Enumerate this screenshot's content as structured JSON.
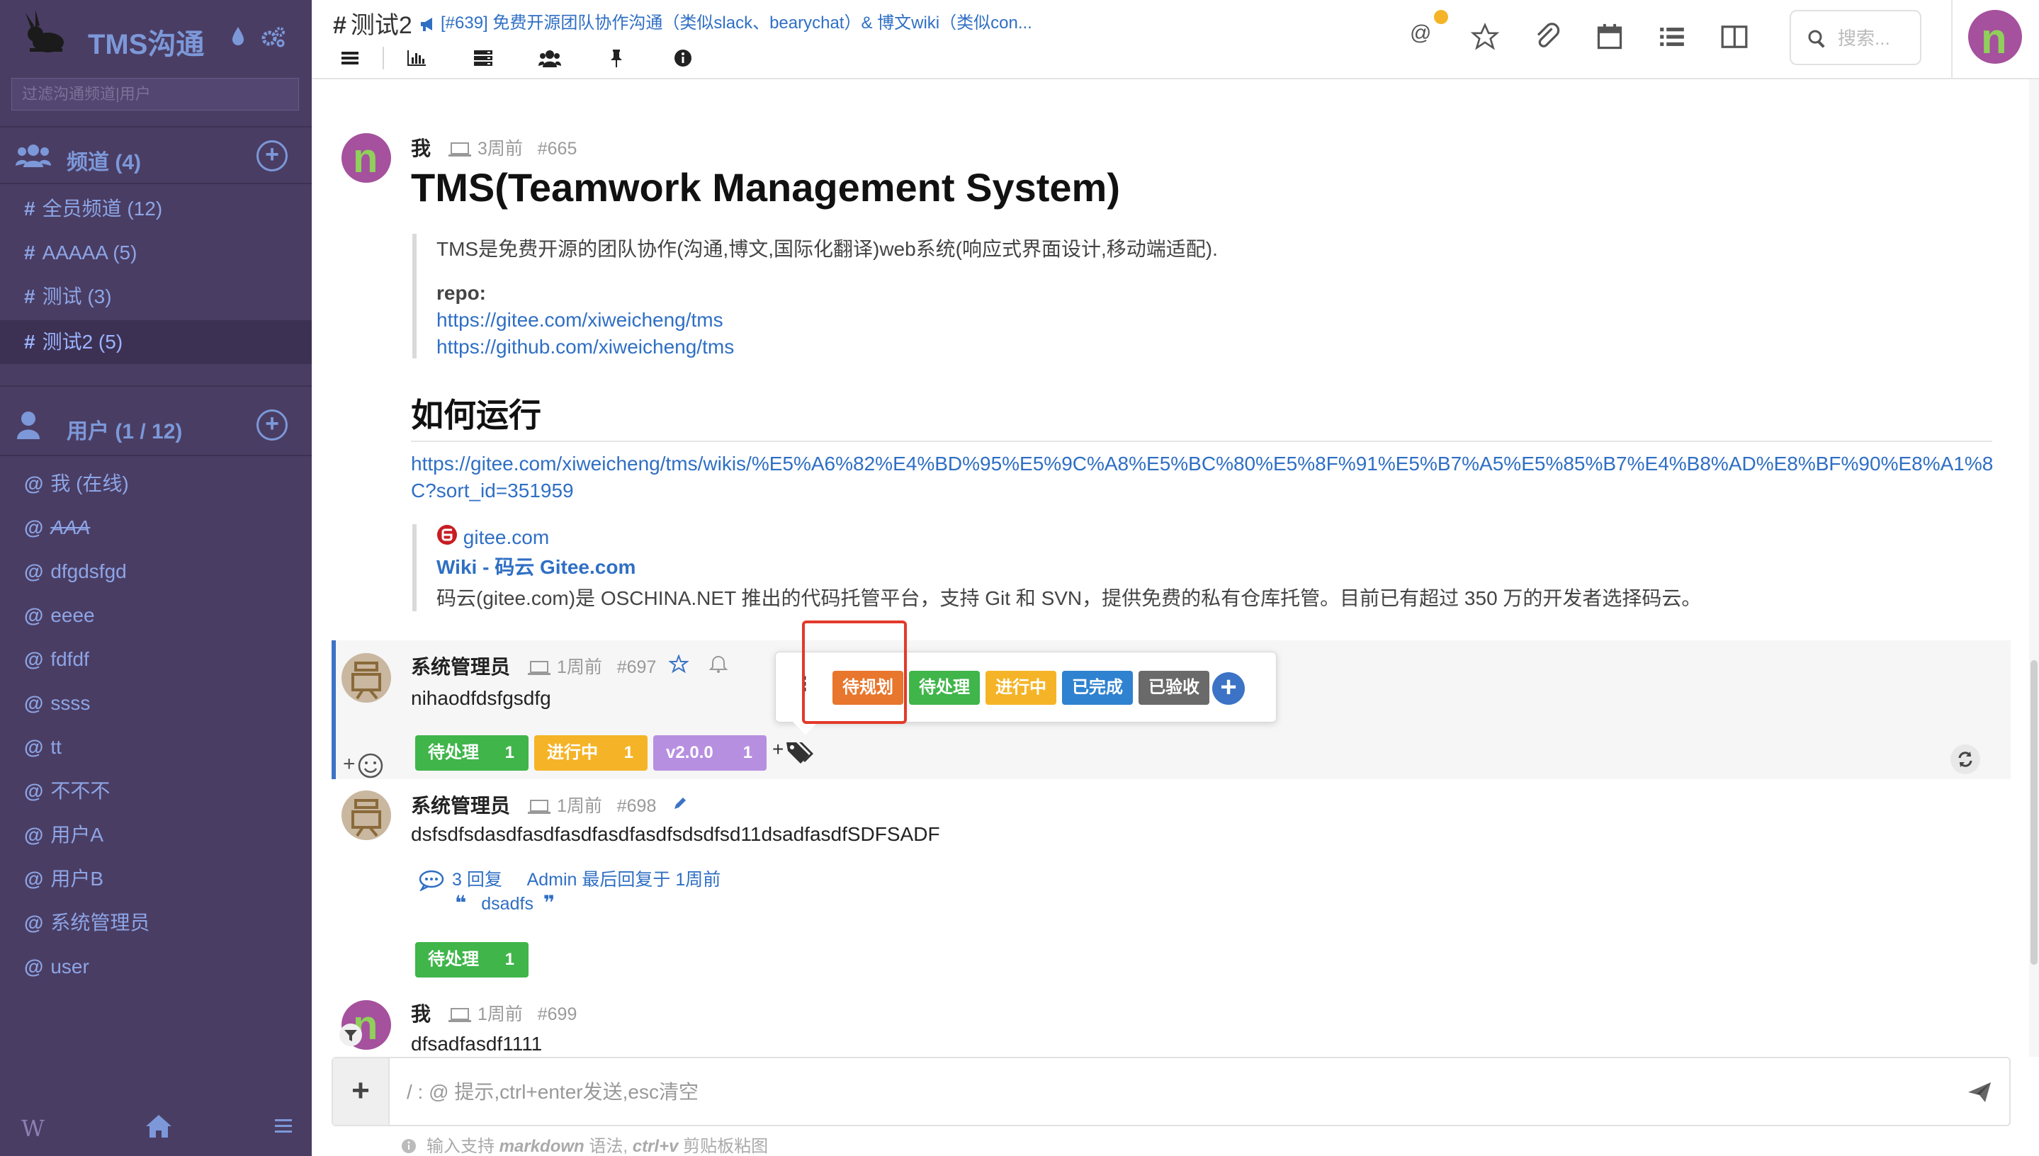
{
  "sidebar": {
    "brand": "TMS沟通",
    "filter_placeholder": "过滤沟通频道|用户",
    "channels_label": "频道 (4)",
    "channels": [
      {
        "prefix": "#",
        "name": "全员频道 (12)"
      },
      {
        "prefix": "#",
        "name": "AAAAA (5)"
      },
      {
        "prefix": "#",
        "name": "测试 (3)"
      },
      {
        "prefix": "#",
        "name": "测试2 (5)"
      }
    ],
    "users_label": "用户 (1 / 12)",
    "users": [
      {
        "prefix": "@",
        "name": "我 (在线)"
      },
      {
        "prefix": "@",
        "name": "AAA"
      },
      {
        "prefix": "@",
        "name": "dfgdsfgd"
      },
      {
        "prefix": "@",
        "name": "eeee"
      },
      {
        "prefix": "@",
        "name": "fdfdf"
      },
      {
        "prefix": "@",
        "name": "ssss"
      },
      {
        "prefix": "@",
        "name": "tt"
      },
      {
        "prefix": "@",
        "name": "不不不"
      },
      {
        "prefix": "@",
        "name": "用户A"
      },
      {
        "prefix": "@",
        "name": "用户B"
      },
      {
        "prefix": "@",
        "name": "系统管理员"
      },
      {
        "prefix": "@",
        "name": "user"
      }
    ],
    "footer_w": "W"
  },
  "header": {
    "channel_hash": "#",
    "channel_name": "测试2",
    "topic": "[#639] 免费开源团队协作沟通（类似slack、bearychat）& 博文wiki（类似con...",
    "search_placeholder": "搜索...",
    "at_symbol": "@",
    "avatar_letter": "n"
  },
  "messages": {
    "m665": {
      "author": "我",
      "time": "3周前",
      "id": "#665",
      "h1": "TMS(Teamwork Management System)",
      "intro": "TMS是免费开源的团队协作(沟通,博文,国际化翻译)web系统(响应式界面设计,移动端适配).",
      "repo_label": "repo:",
      "repo1": "https://gitee.com/xiweicheng/tms",
      "repo2": "https://github.com/xiweicheng/tms",
      "h2": "如何运行",
      "wiki_url": "https://gitee.com/xiweicheng/tms/wikis/%E5%A6%82%E4%BD%95%E5%9C%A8%E5%BC%80%E5%8F%91%E5%B7%A5%E5%85%B7%E4%B8%AD%E8%BF%90%E8%A1%8C?sort_id=351959",
      "card_site": "gitee.com",
      "card_title": "Wiki - 码云 Gitee.com",
      "card_desc": "码云(gitee.com)是 OSCHINA.NET 推出的代码托管平台，支持 Git 和 SVN，提供免费的私有仓库托管。目前已有超过 350 万的开发者选择码云。"
    },
    "m697": {
      "author": "系统管理员",
      "time": "1周前",
      "id": "#697",
      "text": "nihaodfdsfgsdfg",
      "labels": [
        {
          "name": "待处理",
          "count": "1",
          "color": "#3fb54a"
        },
        {
          "name": "进行中",
          "count": "1",
          "color": "#f5b427"
        },
        {
          "name": "v2.0.0",
          "count": "1",
          "color": "#b78fe0"
        }
      ],
      "plus": "+"
    },
    "m698": {
      "author": "系统管理员",
      "time": "1周前",
      "id": "#698",
      "text": "dsfsdfsdasdfasdfasdfasdfasdfsdsdfsd11dsadfasdfSDFSADF",
      "replies": "3 回复",
      "last_reply": "Admin 最后回复于 1周前",
      "quote": "dsadfs",
      "labels": [
        {
          "name": "待处理",
          "count": "1",
          "color": "#3fb54a"
        }
      ]
    },
    "m699": {
      "author": "我",
      "time": "1周前",
      "id": "#699",
      "text": "dfsadfasdf1111"
    }
  },
  "label_popover": {
    "labels": [
      {
        "name": "待规划",
        "color": "#e8762c"
      },
      {
        "name": "待处理",
        "color": "#3fb54a"
      },
      {
        "name": "进行中",
        "color": "#f5b427"
      },
      {
        "name": "已完成",
        "color": "#2f82cf"
      },
      {
        "name": "已验收",
        "color": "#6a6a6a"
      }
    ],
    "highlighted": "待规划",
    "highlight_color": "#e23a2a"
  },
  "composer": {
    "placeholder": "/ : @ 提示,ctrl+enter发送,esc清空",
    "hint_prefix": "输入支持",
    "hint_markdown": "markdown",
    "hint_mid": "语法,",
    "hint_ctrlv": "ctrl+v",
    "hint_suffix": "剪贴板粘图"
  },
  "colors": {
    "sidebar_bg": "#4a3d63",
    "accent_blue": "#3c73c6",
    "link": "#2f6fc4"
  }
}
